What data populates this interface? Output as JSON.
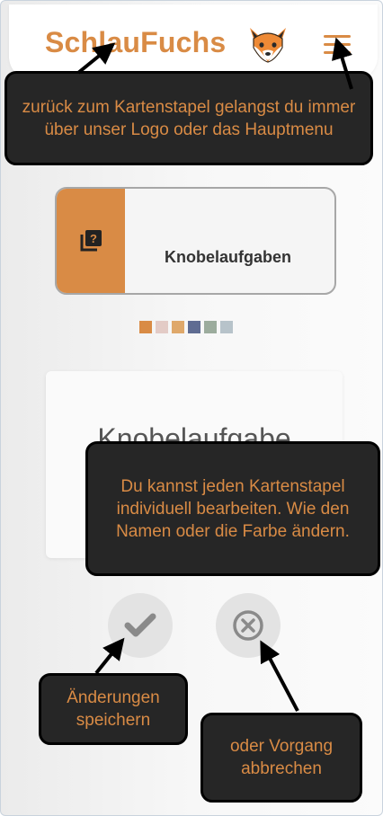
{
  "header": {
    "logo_text": "SchlauFuchs",
    "fox_icon": "fox-emoji",
    "menu_icon": "hamburger-icon"
  },
  "deck": {
    "label": "Knobelaufgaben",
    "icon": "question-cards-icon",
    "color": "#d98b45"
  },
  "swatches": [
    {
      "name": "orange",
      "color": "#d98b45"
    },
    {
      "name": "light-pink",
      "color": "#e3cbc6"
    },
    {
      "name": "sand",
      "color": "#dfa86a"
    },
    {
      "name": "slate-blue",
      "color": "#5f6c92"
    },
    {
      "name": "sage",
      "color": "#9cac9d"
    },
    {
      "name": "light-blue-gray",
      "color": "#b7c3ca"
    }
  ],
  "edit": {
    "name_value": "Knobelaufgabe"
  },
  "actions": {
    "save_icon": "check-icon",
    "cancel_icon": "close-circle-icon"
  },
  "tooltips": {
    "logo_hint": "zurück zum Kartenstapel gelangst du immer über unser Logo oder das Hauptmenu",
    "edit_hint": "Du kannst jeden Kartenstapel individuell bearbeiten. Wie den Namen oder die Farbe ändern.",
    "save_hint": "Änderungen speichern",
    "cancel_hint": "oder Vorgang abbrechen"
  },
  "colors": {
    "accent": "#d98b45",
    "tooltip_bg": "#262626",
    "button_bg": "#e3e3e3"
  }
}
